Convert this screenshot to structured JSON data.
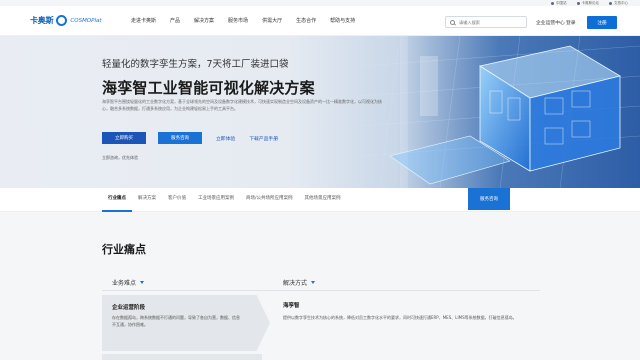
{
  "utility_bar": {
    "items": [
      "中国站",
      "卡奥斯论坛",
      "文档中心"
    ]
  },
  "header": {
    "logo_cn": "卡奥斯",
    "logo_en": "COSMOPlat",
    "nav": [
      "走进卡奥斯",
      "产品",
      "解决方案",
      "服务市场",
      "供需大厅",
      "生态合作",
      "帮助与支持"
    ],
    "search_placeholder": "请输入搜索",
    "console": "企业运营中心",
    "login": "登录",
    "register": "注册"
  },
  "hero": {
    "subtitle": "轻量化的数字孪生方案，7天将工厂装进口袋",
    "title": "海孪智工业智能可视化解决方案",
    "description": "海孪智平台围绕轻量化的工业数字化方案，基于全球领先的空间及设备数字化建模技术，可快速实现制造业空间及设备资产的一比一精准数字化，以可视化为核心，融合多系统数据，打通多系统应用，为企业构建轻松易上手的工具平台。",
    "primary_button": "立即购买",
    "secondary_button": "服务咨询",
    "link_experience": "立即体验",
    "link_manual": "下载产品手册",
    "note": "立即咨询，优先体验"
  },
  "tabs": {
    "items": [
      "行业痛点",
      "解决方案",
      "客户价值",
      "工业场景应用案例",
      "商场/公共场所应用案例",
      "其他场景应用案例"
    ],
    "active_index": 0,
    "consult_button": "服务咨询"
  },
  "section": {
    "title": "行业痛点",
    "left_header": "业务难点",
    "right_header": "解决方式",
    "pain": {
      "title": "企业运营阶段",
      "description": "存在数据孤岛，跨系统数据不打通的问题，导致了各自为营，数据、信息不互通，协作困难。"
    },
    "solution": {
      "title": "海孪智",
      "description": "提供以数字孪生技术为核心的系统，降低对员工数字化水平的要求，同时可快速打通ERP、MES、LIMS等系统数据，打破信息孤岛。"
    }
  },
  "colors": {
    "brand_blue": "#1a73d4",
    "primary_button": "#1d54b8",
    "logo_blue": "#0b5fb5"
  }
}
